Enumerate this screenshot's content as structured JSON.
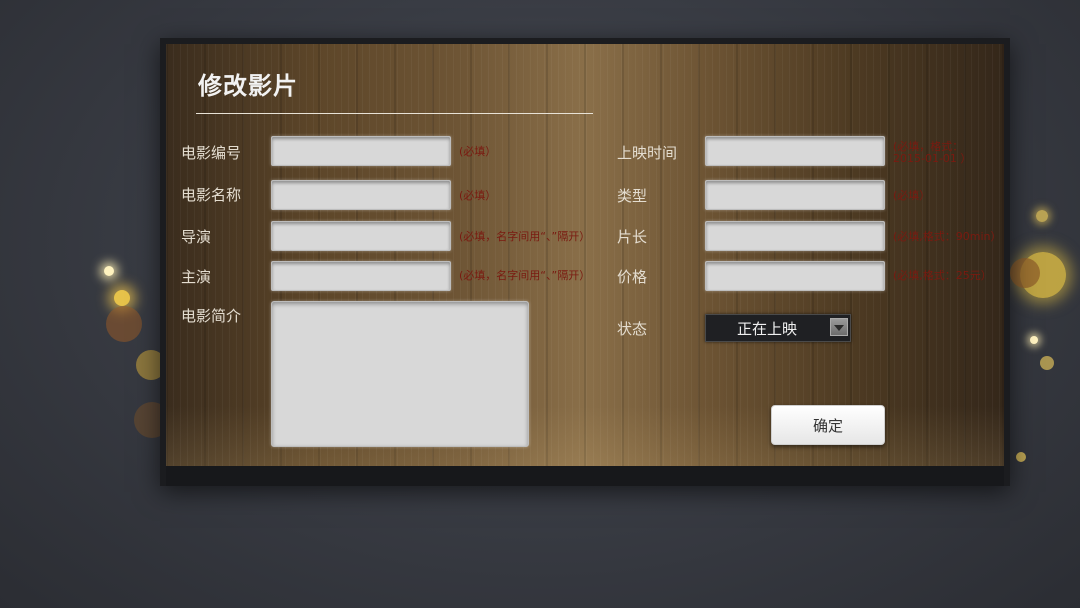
{
  "page": {
    "title": "修改影片"
  },
  "form": {
    "movie_id": {
      "label": "电影编号",
      "value": "",
      "hint": "(必填）"
    },
    "movie_name": {
      "label": "电影名称",
      "value": "",
      "hint": "(必填）"
    },
    "director": {
      "label": "导演",
      "value": "",
      "hint": "(必填，名字间用“、”隔开）"
    },
    "actors": {
      "label": "主演",
      "value": "",
      "hint": "(必填，名字间用“、”隔开）"
    },
    "synopsis": {
      "label": "电影简介",
      "value": ""
    },
    "release_time": {
      "label": "上映时间",
      "value": "",
      "hint_line1": "(必填，格式：",
      "hint_line2": "2015-01-01 ）"
    },
    "genre": {
      "label": "类型",
      "value": "",
      "hint": "(必填）"
    },
    "duration": {
      "label": "片长",
      "value": "",
      "hint": "(必填,格式：90min）"
    },
    "price": {
      "label": "价格",
      "value": "",
      "hint": "(必填,格式：25元）"
    },
    "status": {
      "label": "状态",
      "selected": "正在上映"
    }
  },
  "actions": {
    "confirm_label": "确定"
  },
  "colors": {
    "hint": "#7a1a10",
    "label": "#e4ddd0",
    "panel_wood": "#6e5535"
  }
}
